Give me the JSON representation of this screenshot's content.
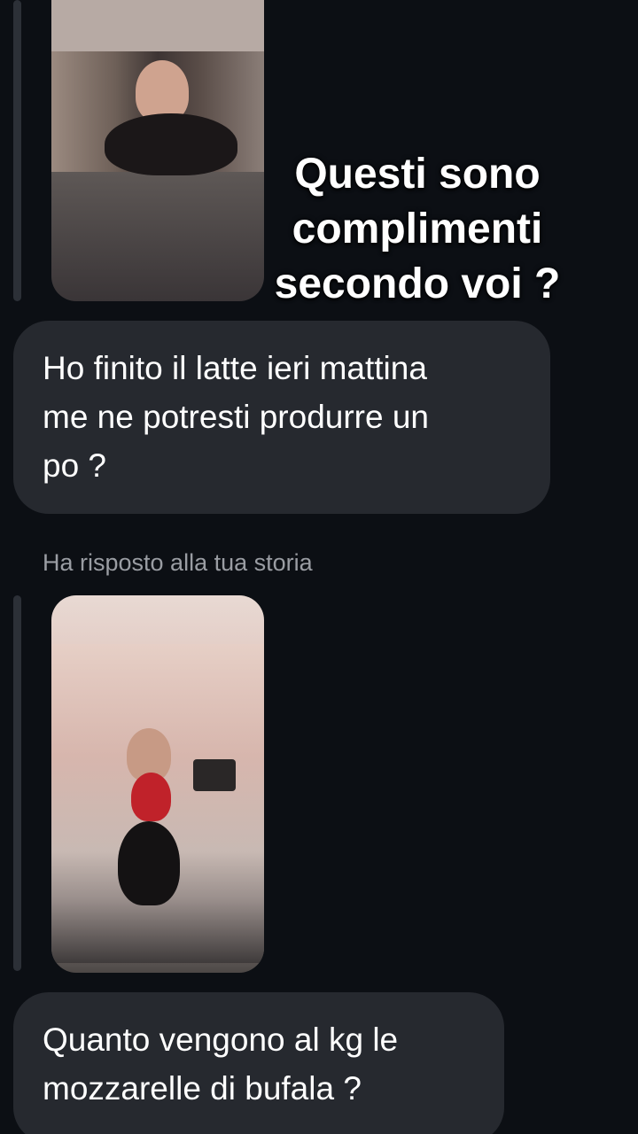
{
  "overlay_caption": "Questi sono\ncomplimenti\nsecondo voi ?",
  "messages": [
    {
      "type": "story-reply-image",
      "image": "story-photo-1"
    },
    {
      "type": "text",
      "text": "Ho finito il latte ieri mattina\nme ne potresti produrre un\npo ?"
    },
    {
      "type": "reply-note",
      "text": "Ha risposto alla tua storia"
    },
    {
      "type": "story-reply-image",
      "image": "story-photo-2"
    },
    {
      "type": "text",
      "text": "Quanto vengono al kg le\nmozzarelle di bufala ?"
    }
  ],
  "colors": {
    "background": "#0c0f14",
    "bubble": "#26292f",
    "reply_line": "#2c3037",
    "reply_note_text": "#9a9da3",
    "text": "#ffffff"
  }
}
